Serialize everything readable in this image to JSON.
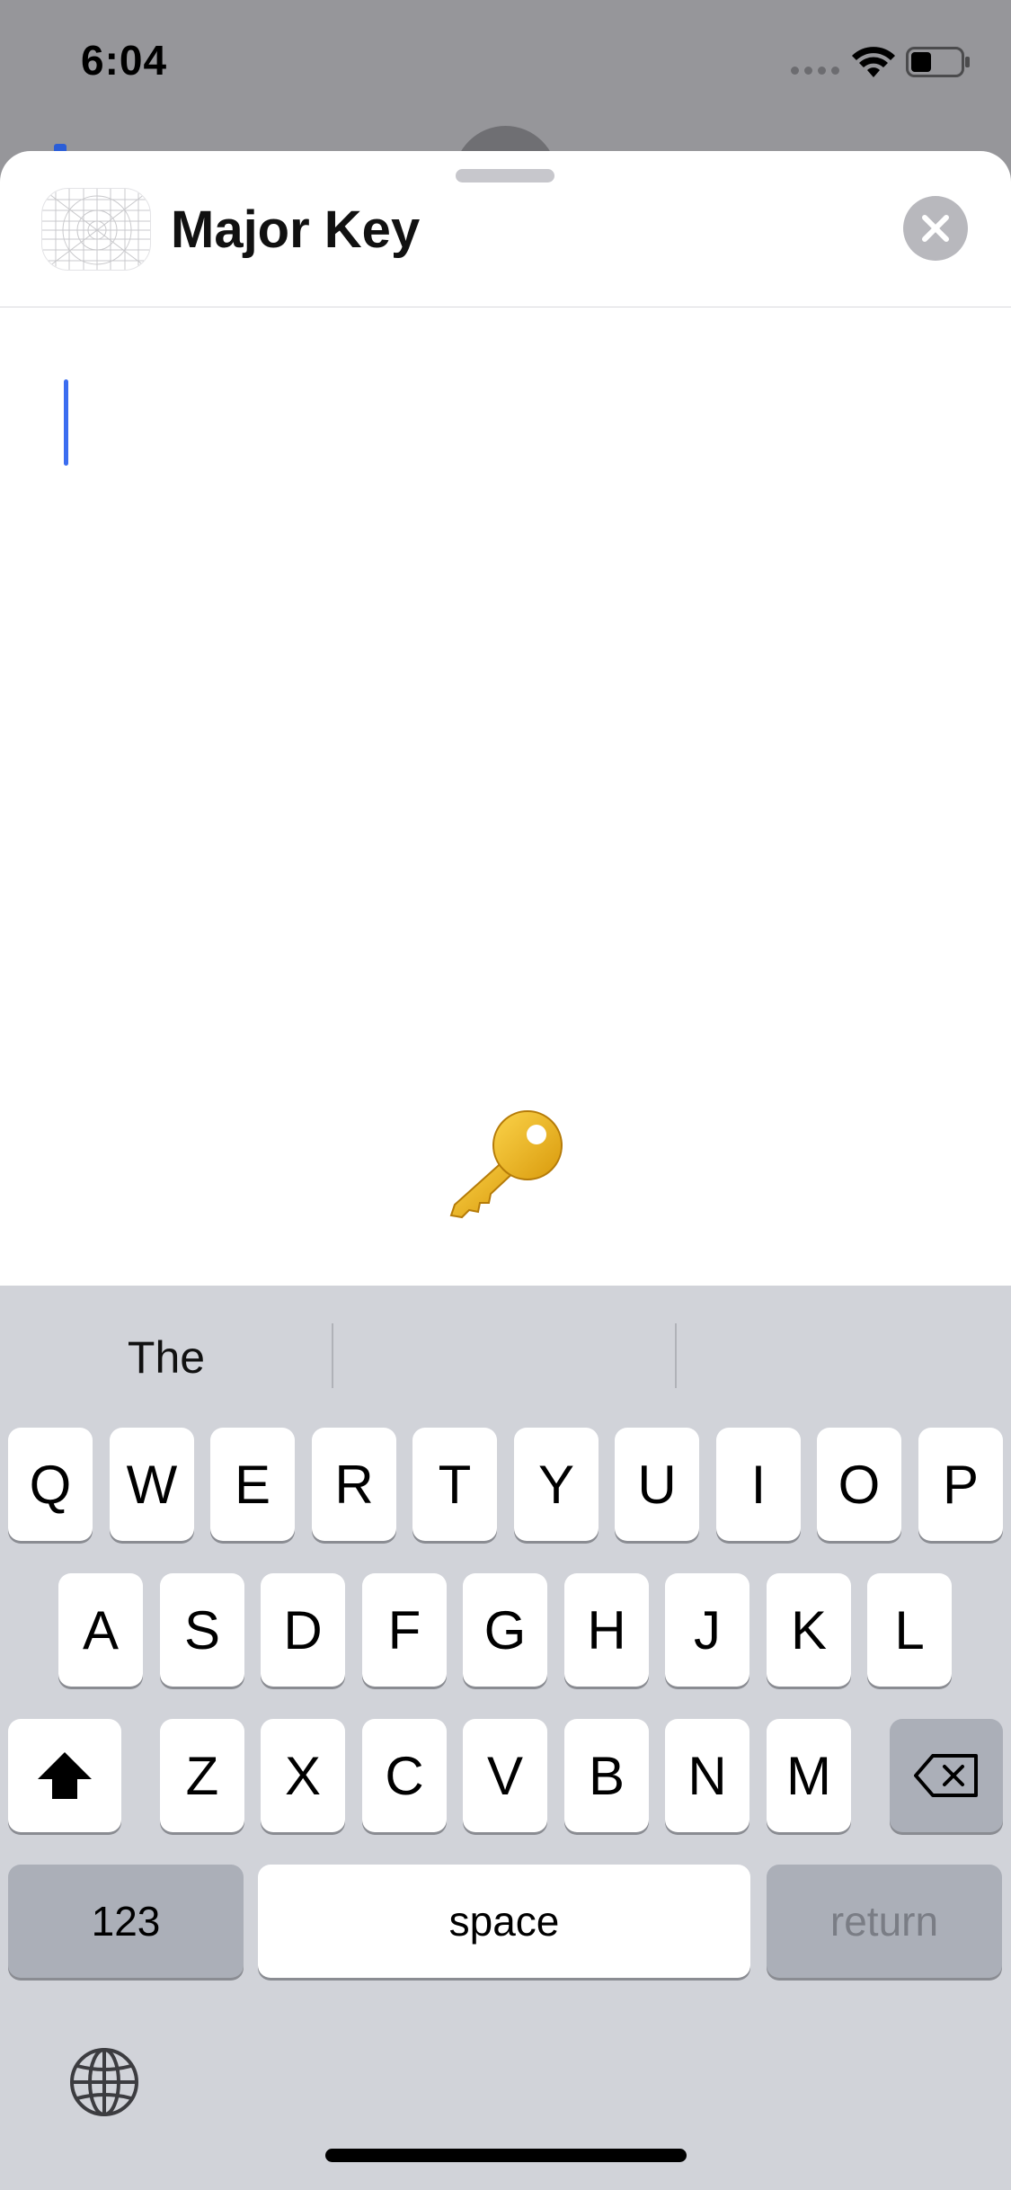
{
  "status_bar": {
    "time": "6:04",
    "icons": [
      "signal-dots-icon",
      "wifi-icon",
      "battery-icon"
    ]
  },
  "sheet": {
    "title": "Major Key",
    "app_icon": "app-grid-icon",
    "close_icon": "close-icon",
    "text_input_value": "",
    "sticker": "key-emoji-icon"
  },
  "keyboard": {
    "predictions": [
      "The",
      "",
      ""
    ],
    "row1": [
      "Q",
      "W",
      "E",
      "R",
      "T",
      "Y",
      "U",
      "I",
      "O",
      "P"
    ],
    "row2": [
      "A",
      "S",
      "D",
      "F",
      "G",
      "H",
      "J",
      "K",
      "L"
    ],
    "row3": [
      "Z",
      "X",
      "C",
      "V",
      "B",
      "N",
      "M"
    ],
    "shift_icon": "shift-icon",
    "delete_icon": "backspace-icon",
    "numbers_label": "123",
    "space_label": "space",
    "return_label": "return",
    "globe_icon": "globe-icon"
  },
  "colors": {
    "cursor": "#3b6df0",
    "keyboard_bg": "#d1d3d9",
    "dimmed_bg": "#96969a"
  }
}
